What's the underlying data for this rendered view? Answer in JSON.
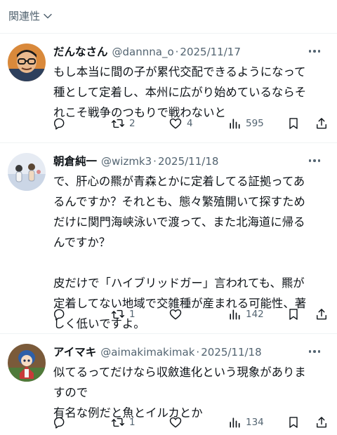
{
  "sort_bar": {
    "label": "関連性"
  },
  "tweets": [
    {
      "name": "だんなさん",
      "handle": "@dannna_o",
      "separator": "·",
      "date": "2025/11/17",
      "text": "もし本当に間の子が累代交配できるようになって\n種として定着し、本州に広がり始めているならそ\nれこそ戦争のつもりで戦わないと",
      "reply_count": "",
      "retweet_count": "2",
      "like_count": "4",
      "view_count": "595"
    },
    {
      "name": "朝倉純一",
      "handle": "@wizmk3",
      "separator": "·",
      "date": "2025/11/18",
      "text": "で、肝心の羆が青森とかに定着してる証拠ってあ\nるんですか？それとも、態々繁殖開いて探すため\nだけに関門海峡泳いで渡って、また北海道に帰る\nんですか？\n\n皮だけで「ハイブリッドガー」言われても、羆が\n定着してない地域で交雑種が産まれる可能性、著\nしく低いですよ。",
      "reply_count": "",
      "retweet_count": "1",
      "like_count": "",
      "view_count": "142"
    },
    {
      "name": "アイマキ",
      "handle": "@aimakimakimak",
      "separator": "·",
      "date": "2025/11/18",
      "text": "似てるってだけなら収斂進化という現象がありま\nすので\n有名な例だと魚とイルカとか",
      "reply_count": "",
      "retweet_count": "1",
      "like_count": "",
      "view_count": "134"
    }
  ],
  "icons": {
    "sort": "chevron-down-icon",
    "more": "more-icon",
    "reply": "reply-icon",
    "retweet": "retweet-icon",
    "like": "heart-icon",
    "views": "views-icon",
    "bookmark": "bookmark-icon",
    "share": "share-icon"
  },
  "colors": {
    "text": "#0f1419",
    "secondary": "#536471",
    "divider": "#eff3f4"
  }
}
